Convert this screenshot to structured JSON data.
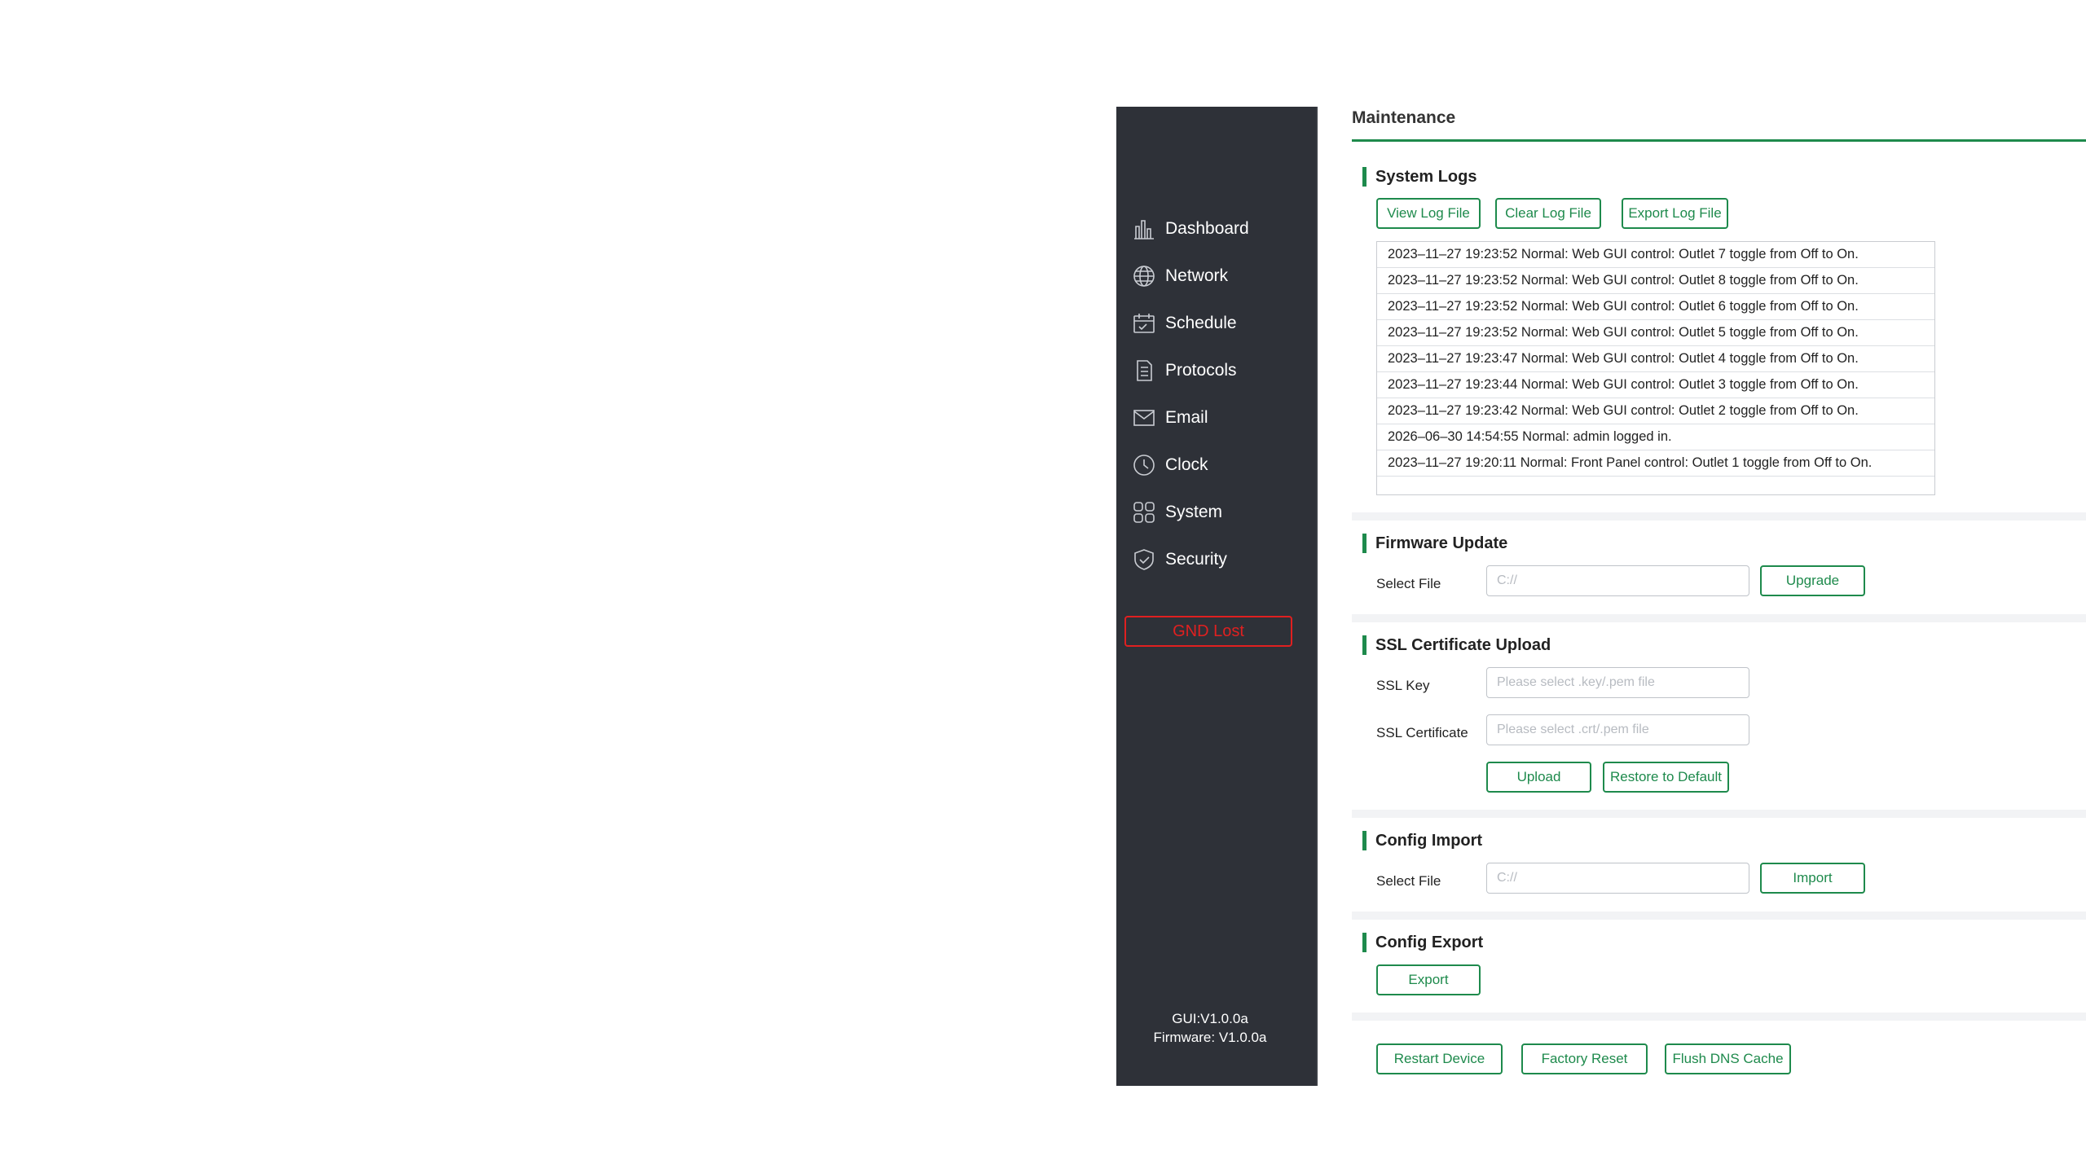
{
  "sidebar": {
    "items": [
      {
        "label": "Dashboard",
        "icon": "dashboard-icon"
      },
      {
        "label": "Network",
        "icon": "globe-icon"
      },
      {
        "label": "Schedule",
        "icon": "calendar-icon"
      },
      {
        "label": "Protocols",
        "icon": "document-icon"
      },
      {
        "label": "Email",
        "icon": "envelope-icon"
      },
      {
        "label": "Clock",
        "icon": "clock-icon"
      },
      {
        "label": "System",
        "icon": "grid-icon"
      },
      {
        "label": "Security",
        "icon": "shield-icon"
      }
    ],
    "status": "GND Lost",
    "gui_version": "GUI:V1.0.0a",
    "firmware_version": "Firmware: V1.0.0a"
  },
  "main": {
    "title": "Maintenance",
    "system_logs": {
      "title": "System Logs",
      "view_label": "View Log File",
      "clear_label": "Clear Log File",
      "export_label": "Export Log File",
      "entries": [
        "2023–11–27 19:23:52 Normal: Web GUI control: Outlet 7 toggle from Off to On.",
        "2023–11–27 19:23:52 Normal: Web GUI control: Outlet 8 toggle from Off to On.",
        "2023–11–27 19:23:52 Normal: Web GUI control: Outlet 6 toggle from Off to On.",
        "2023–11–27 19:23:52 Normal: Web GUI control: Outlet 5 toggle from Off to On.",
        "2023–11–27 19:23:47 Normal: Web GUI control: Outlet 4 toggle from Off to On.",
        "2023–11–27 19:23:44 Normal: Web GUI control: Outlet 3 toggle from Off to On.",
        "2023–11–27 19:23:42 Normal: Web GUI control: Outlet 2 toggle from Off to On.",
        "2026–06–30 14:54:55 Normal: admin logged in.",
        "2023–11–27 19:20:11 Normal: Front Panel control: Outlet 1 toggle from Off to On.",
        ""
      ]
    },
    "firmware_update": {
      "title": "Firmware Update",
      "select_label": "Select File",
      "placeholder": "C://",
      "button": "Upgrade"
    },
    "ssl": {
      "title": "SSL Certificate Upload",
      "key_label": "SSL Key",
      "key_placeholder": "Please select .key/.pem file",
      "cert_label": "SSL Certificate",
      "cert_placeholder": "Please select .crt/.pem file",
      "upload_button": "Upload",
      "restore_button": "Restore to Default"
    },
    "config_import": {
      "title": "Config Import",
      "select_label": "Select File",
      "placeholder": "C://",
      "button": "Import"
    },
    "config_export": {
      "title": "Config Export",
      "button": "Export"
    },
    "actions": {
      "restart": "Restart Device",
      "factory_reset": "Factory Reset",
      "flush_dns": "Flush DNS Cache"
    }
  },
  "colors": {
    "accent": "#1e8a4c",
    "sidebar_bg": "#2e3138",
    "alert": "#e02020"
  }
}
